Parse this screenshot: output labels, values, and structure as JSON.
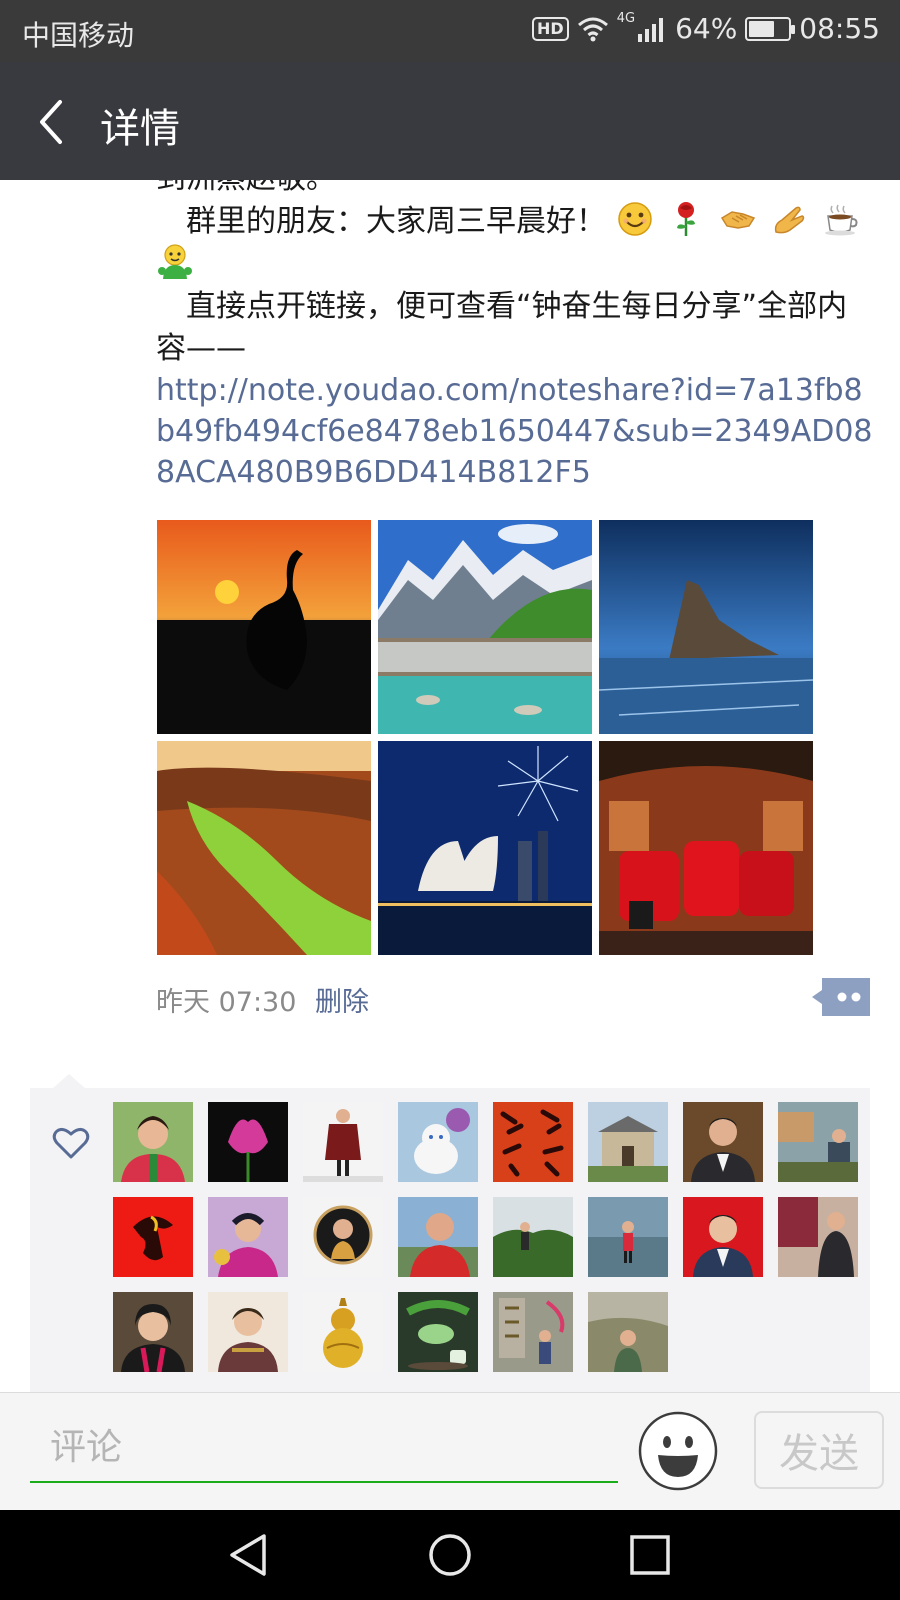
{
  "status_bar": {
    "carrier": "中国移动",
    "hd": "HD",
    "network": "4G",
    "battery": "64%",
    "battery_level": 0.64,
    "time": "08:55"
  },
  "header": {
    "title": "详情"
  },
  "post": {
    "cut_line": "到洲蒸赵敬。",
    "greeting": "群里的朋友：大家周三早晨好！",
    "instruction": "直接点开链接，便可查看“钟奋生每日分享”全部内容——",
    "link": "http://note.youdao.com/noteshare?id=7a13fb8b49fb494cf6e8478eb1650447&sub=2349AD088ACA480B9B6DD414B812F5",
    "time": "昨天 07:30",
    "delete_label": "删除"
  },
  "comment": {
    "placeholder": "评论",
    "send_label": "发送"
  },
  "colors": {
    "link": "#576b95",
    "accent_green": "#1aad19",
    "title_bar": "#393a3f"
  }
}
